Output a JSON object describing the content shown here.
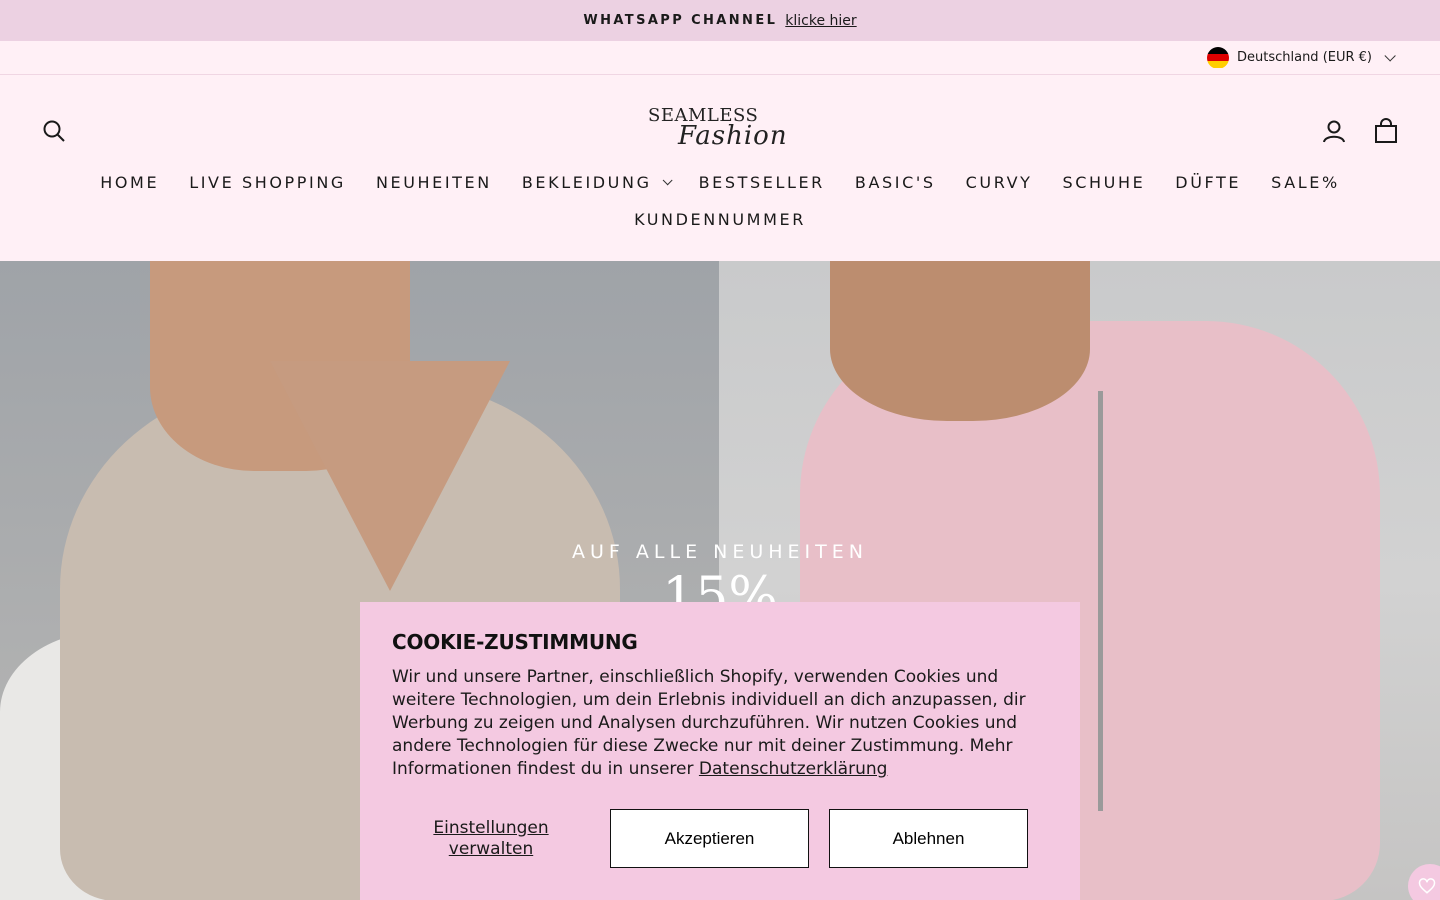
{
  "announcement": {
    "label": "WHATSAPP CHANNEL",
    "link": "klicke hier"
  },
  "utility": {
    "locale": "Deutschland (EUR €)"
  },
  "header": {
    "logo_line1": "SEAMLESS",
    "logo_line2": "Fashion",
    "icons": {
      "search": "search-icon",
      "account": "user-icon",
      "cart": "bag-icon"
    }
  },
  "nav": {
    "items": [
      "HOME",
      "LIVE SHOPPING",
      "NEUHEITEN",
      "BEKLEIDUNG",
      "BESTSELLER",
      "BASIC'S",
      "CURVY",
      "SCHUHE",
      "DÜFTE",
      "SALE%"
    ],
    "second_row": "KUNDENNUMMER"
  },
  "hero": {
    "subtitle": "AUF ALLE NEUHEITEN",
    "headline": "15%"
  },
  "cookie": {
    "title": "COOKIE-ZUSTIMMUNG",
    "body": "Wir und unsere Partner, einschließlich Shopify, verwenden Cookies und weitere Technologien, um dein Erlebnis individuell an dich anzupassen, dir Werbung zu zeigen und Analysen durchzuführen. Wir nutzen Cookies und andere Technologien für diese Zwecke nur mit deiner Zustimmung. Mehr Informationen findest du in unserer ",
    "privacy_link": "Datenschutzerklärung",
    "manage": "Einstellungen verwalten",
    "accept": "Akzeptieren",
    "decline": "Ablehnen"
  },
  "colors": {
    "announcement_bg": "#ecd1e2",
    "header_bg": "#fff0f6",
    "cookie_bg": "#f4c9e1"
  }
}
